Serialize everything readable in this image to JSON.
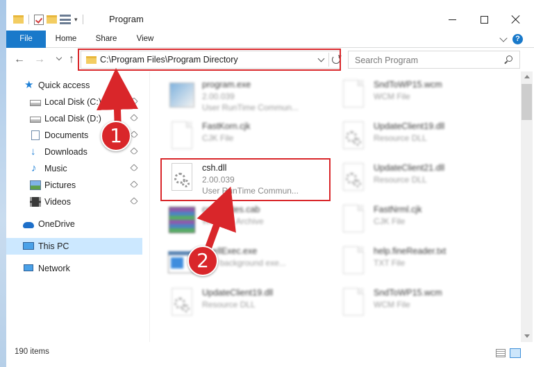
{
  "window": {
    "title": "Program"
  },
  "ribbon": {
    "file": "File",
    "home": "Home",
    "share": "Share",
    "view": "View",
    "help": "?"
  },
  "address": {
    "path": "C:\\Program Files\\Program Directory"
  },
  "search": {
    "placeholder": "Search Program"
  },
  "nav": {
    "quick_access": "Quick access",
    "items": [
      {
        "label": "Local Disk (C:)",
        "icon": "disk-icon"
      },
      {
        "label": "Local Disk (D:)",
        "icon": "disk-icon"
      },
      {
        "label": "Documents",
        "icon": "documents-icon"
      },
      {
        "label": "Downloads",
        "icon": "downloads-icon"
      },
      {
        "label": "Music",
        "icon": "music-icon"
      },
      {
        "label": "Pictures",
        "icon": "pictures-icon"
      },
      {
        "label": "Videos",
        "icon": "videos-icon"
      }
    ],
    "onedrive": "OneDrive",
    "this_pc": "This PC",
    "network": "Network"
  },
  "files": [
    {
      "name": "program.exe",
      "line1": "2.00.039",
      "line2": "User RunTime Commun...",
      "icon": "exe"
    },
    {
      "name": "SndToWP15.wcm",
      "line1": "WCM File",
      "line2": "",
      "icon": "page"
    },
    {
      "name": "FastKorn.cjk",
      "line1": "CJK File",
      "line2": "",
      "icon": "page"
    },
    {
      "name": "UpdateClient19.dll",
      "line1": "Resource DLL",
      "line2": "",
      "icon": "gear"
    },
    {
      "name": "csh.dll",
      "line1": "2.00.039",
      "line2": "User RunTime Commun...",
      "icon": "gear"
    },
    {
      "name": "UpdateClient21.dll",
      "line1": "Resource DLL",
      "line2": "",
      "icon": "gear"
    },
    {
      "name": "certificates.cab",
      "line1": "WinRAR Archive",
      "line2": "",
      "icon": "archive"
    },
    {
      "name": "FastNrml.cjk",
      "line1": "CJK File",
      "line2": "",
      "icon": "page"
    },
    {
      "name": "ShellExec.exe",
      "line1": "Run background exe...",
      "line2": "",
      "icon": "exec"
    },
    {
      "name": "help.fineReader.txt",
      "line1": "TXT File",
      "line2": "",
      "icon": "page"
    },
    {
      "name": "UpdateClient19.dll",
      "line1": "Resource DLL",
      "line2": "",
      "icon": "gear"
    },
    {
      "name": "SndToWP15.wcm",
      "line1": "WCM File",
      "line2": "",
      "icon": "page"
    }
  ],
  "annotations": {
    "step1": "1",
    "step2": "2",
    "highlight_color": "#d9262a"
  },
  "status": {
    "item_count": "190 items"
  },
  "colors": {
    "accent": "#1979ca",
    "selection": "#cce8ff"
  }
}
